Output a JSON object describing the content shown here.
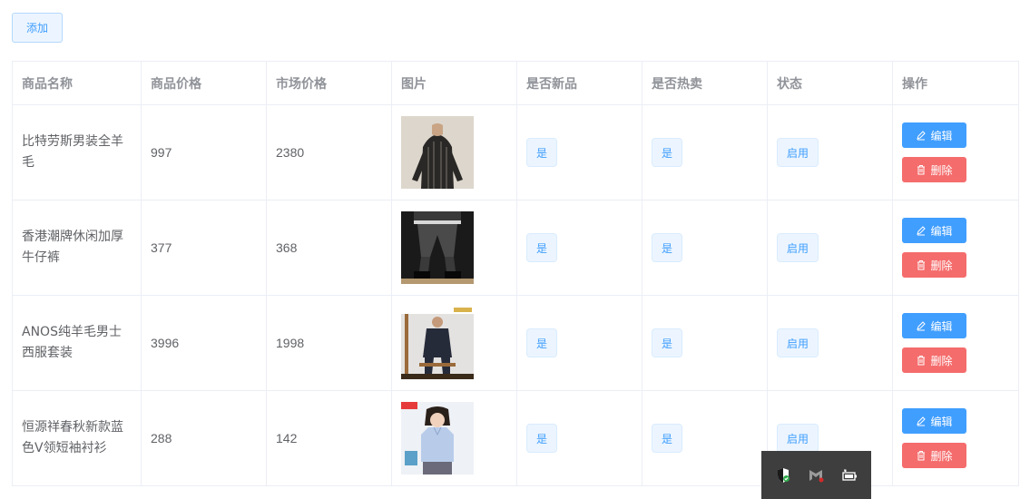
{
  "toolbar": {
    "add_label": "添加"
  },
  "table": {
    "headers": [
      "商品名称",
      "商品价格",
      "市场价格",
      "图片",
      "是否新品",
      "是否热卖",
      "状态",
      "操作"
    ],
    "rows": [
      {
        "name": "比特劳斯男装全羊毛",
        "price": "997",
        "market_price": "2380",
        "is_new": "是",
        "is_hot": "是",
        "status": "启用",
        "edit": "编辑",
        "delete": "删除"
      },
      {
        "name": "香港潮牌休闲加厚牛仔裤",
        "price": "377",
        "market_price": "368",
        "is_new": "是",
        "is_hot": "是",
        "status": "启用",
        "edit": "编辑",
        "delete": "删除"
      },
      {
        "name": "ANOS纯羊毛男士西服套装",
        "price": "3996",
        "market_price": "1998",
        "is_new": "是",
        "is_hot": "是",
        "status": "启用",
        "edit": "编辑",
        "delete": "删除"
      },
      {
        "name": "恒源祥春秋新款蓝色V领短袖衬衫",
        "price": "288",
        "market_price": "142",
        "is_new": "是",
        "is_hot": "是",
        "status": "启用",
        "edit": "编辑",
        "delete": "删除"
      }
    ]
  },
  "tray": {
    "icons": [
      "shield-check-icon",
      "mcafee-icon",
      "battery-icon"
    ]
  },
  "colors": {
    "primary": "#409eff",
    "danger": "#f56c6c",
    "tag_bg": "#ecf5ff",
    "border": "#ebeef5"
  }
}
